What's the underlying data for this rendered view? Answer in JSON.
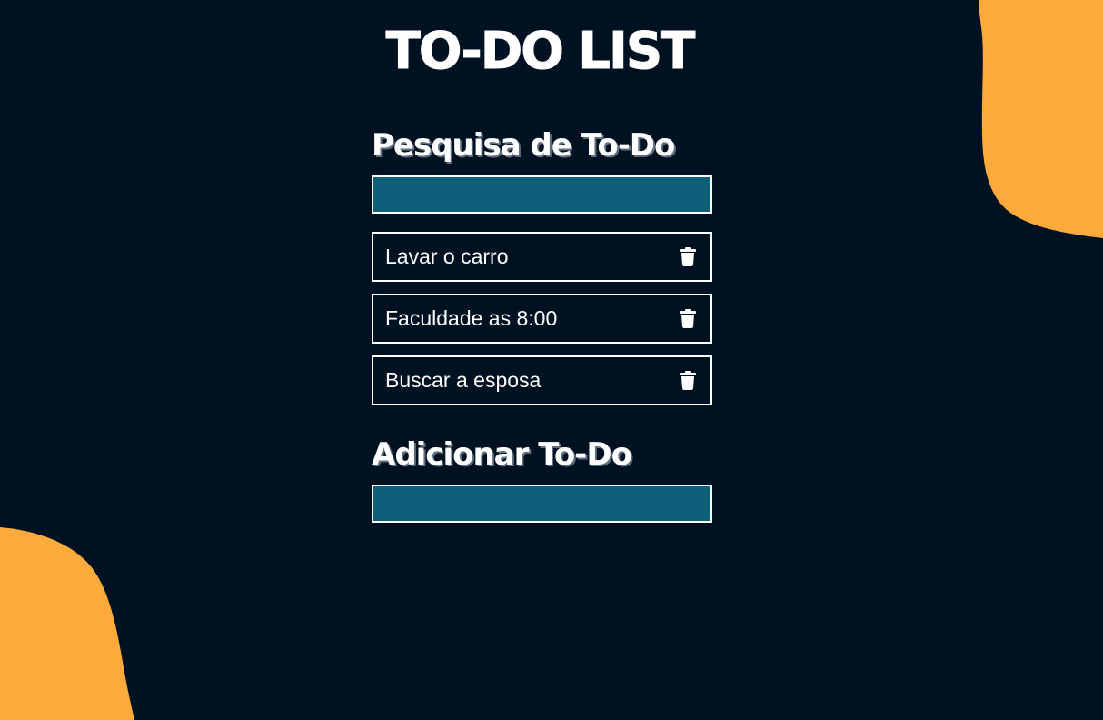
{
  "app": {
    "title": "TO-DO LIST"
  },
  "search": {
    "title": "Pesquisa de To-Do",
    "value": "",
    "placeholder": ""
  },
  "todos": {
    "items": [
      {
        "text": "Lavar o carro",
        "delete_icon": "trash-icon"
      },
      {
        "text": "Faculdade as 8:00",
        "delete_icon": "trash-icon"
      },
      {
        "text": "Buscar a esposa",
        "delete_icon": "trash-icon"
      }
    ]
  },
  "add": {
    "title": "Adicionar To-Do",
    "value": "",
    "placeholder": ""
  },
  "colors": {
    "background": "#001122",
    "accent_blob": "#FBAA3B",
    "input_fill": "#0D5F7A",
    "text": "#FFFFFF"
  }
}
